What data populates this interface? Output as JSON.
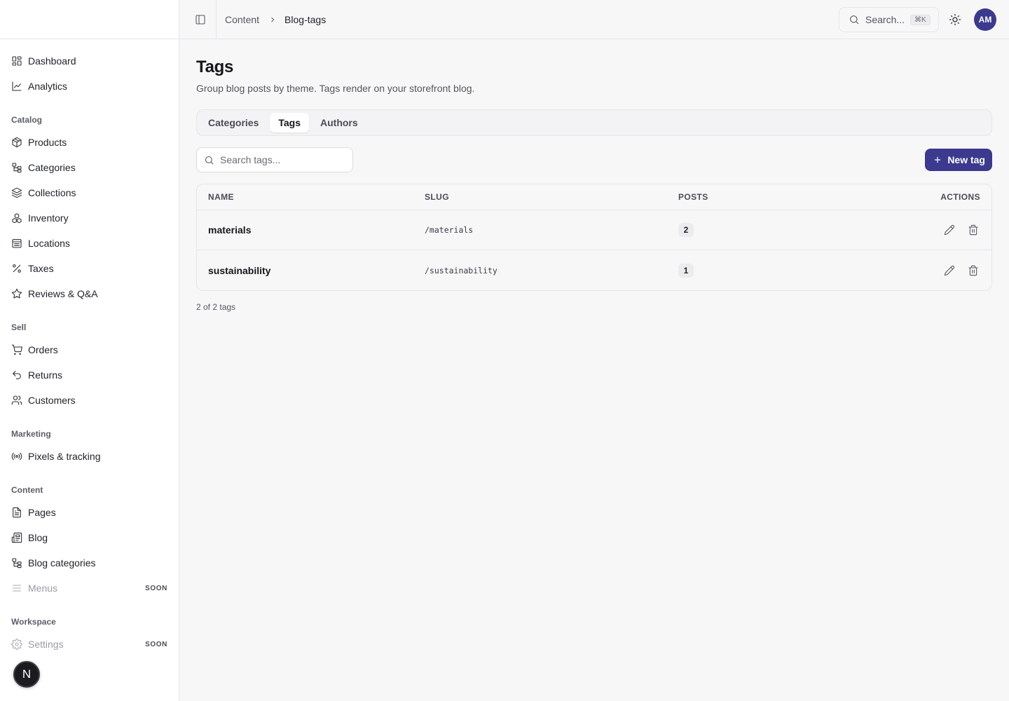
{
  "sidebar": {
    "items_top": [
      {
        "label": "Dashboard",
        "icon": "dashboard-icon"
      },
      {
        "label": "Analytics",
        "icon": "analytics-icon"
      }
    ],
    "sections": [
      {
        "title": "Catalog",
        "items": [
          {
            "label": "Products",
            "icon": "package-icon"
          },
          {
            "label": "Categories",
            "icon": "tree-icon"
          },
          {
            "label": "Collections",
            "icon": "layers-icon"
          },
          {
            "label": "Inventory",
            "icon": "boxes-icon"
          },
          {
            "label": "Locations",
            "icon": "building-icon"
          },
          {
            "label": "Taxes",
            "icon": "percent-icon"
          },
          {
            "label": "Reviews & Q&A",
            "icon": "star-icon"
          }
        ]
      },
      {
        "title": "Sell",
        "items": [
          {
            "label": "Orders",
            "icon": "cart-icon"
          },
          {
            "label": "Returns",
            "icon": "undo-icon"
          },
          {
            "label": "Customers",
            "icon": "users-icon"
          }
        ]
      },
      {
        "title": "Marketing",
        "items": [
          {
            "label": "Pixels & tracking",
            "icon": "radio-icon"
          }
        ]
      },
      {
        "title": "Content",
        "items": [
          {
            "label": "Pages",
            "icon": "file-icon"
          },
          {
            "label": "Blog",
            "icon": "newspaper-icon"
          },
          {
            "label": "Blog categories",
            "icon": "tree-icon"
          },
          {
            "label": "Menus",
            "icon": "menu-icon",
            "badge": "SOON",
            "disabled": true
          }
        ]
      },
      {
        "title": "Workspace",
        "items": [
          {
            "label": "Settings",
            "icon": "gear-icon",
            "badge": "SOON",
            "disabled": true
          }
        ]
      }
    ],
    "floating_badge": "N"
  },
  "header": {
    "breadcrumb": {
      "parent": "Content",
      "current": "Blog-tags"
    },
    "search_label": "Search...",
    "search_shortcut": "⌘K",
    "avatar_initials": "AM"
  },
  "main": {
    "title": "Tags",
    "subtitle": "Group blog posts by theme. Tags render on your storefront blog.",
    "tabs": [
      {
        "label": "Categories",
        "active": false
      },
      {
        "label": "Tags",
        "active": true
      },
      {
        "label": "Authors",
        "active": false
      }
    ],
    "search_placeholder": "Search tags...",
    "new_button_label": "New tag",
    "accent_color": "#3b3a8f",
    "table": {
      "columns": {
        "name": "NAME",
        "slug": "SLUG",
        "posts": "POSTS",
        "actions": "ACTIONS"
      },
      "rows": [
        {
          "name": "materials",
          "slug": "/materials",
          "posts": "2"
        },
        {
          "name": "sustainability",
          "slug": "/sustainability",
          "posts": "1"
        }
      ]
    },
    "count_text": "2 of 2 tags"
  }
}
